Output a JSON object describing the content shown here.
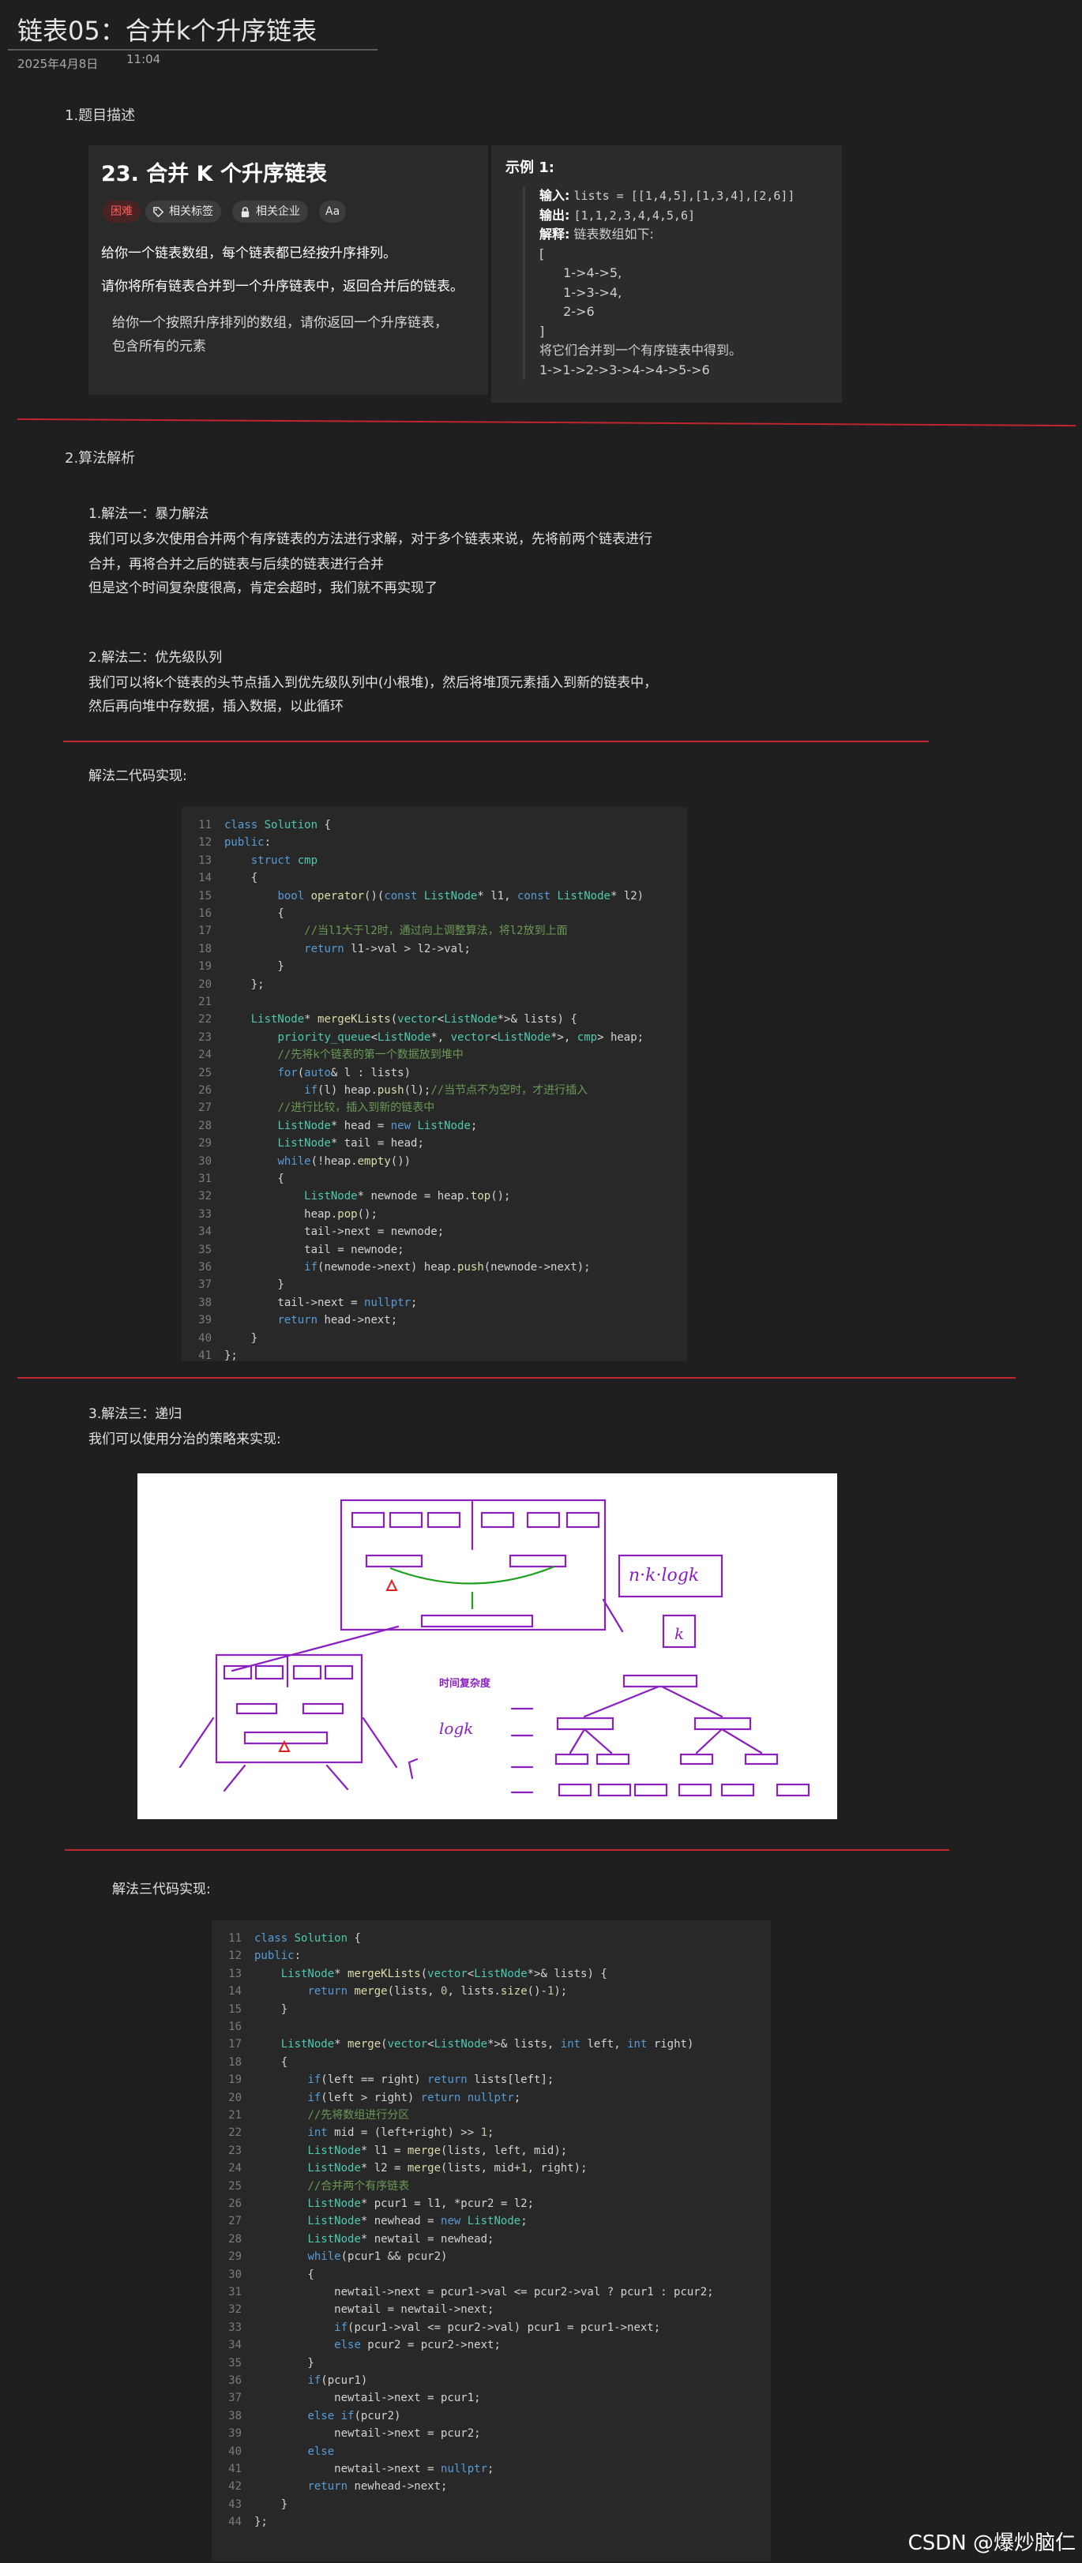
{
  "header": {
    "title": "链表05：合并k个升序链表",
    "date": "2025年4月8日",
    "time": "11:04"
  },
  "sections": {
    "s1": "1.题目描述",
    "s2": "2.算法解析",
    "code2_title": "解法二代码实现:",
    "code3_title": "解法三代码实现:"
  },
  "problem": {
    "title": "23. 合并 K 个升序链表",
    "tags": [
      "困难",
      "相关标签",
      "相关企业",
      "Aa"
    ],
    "desc1": "给你一个链表数组，每个链表都已经按升序排列。",
    "desc2": "请你将所有链表合并到一个升序链表中，返回合并后的链表。",
    "note1": "给你一个按照升序排列的数组，请你返回一个升序链表，",
    "note2": "包含所有的元素"
  },
  "example": {
    "title": "示例 1:",
    "input_k": "输入:",
    "input_v": "lists = [[1,4,5],[1,3,4],[2,6]]",
    "output_k": "输出:",
    "output_v": "[1,1,2,3,4,4,5,6]",
    "explain_k": "解释:",
    "explain_v": "链表数组如下:",
    "lines": [
      "[",
      "  1->4->5,",
      "  1->3->4,",
      "  2->6",
      "]"
    ],
    "merge_text": "将它们合并到一个有序链表中得到。",
    "result": "1->1->2->3->4->4->5->6"
  },
  "method1": {
    "title": "1.解法一：暴力解法",
    "lines": [
      "我们可以多次使用合并两个有序链表的方法进行求解，对于多个链表来说，先将前两个链表进行",
      "合并，再将合并之后的链表与后续的链表进行合并",
      "但是这个时间复杂度很高，肯定会超时，我们就不再实现了"
    ]
  },
  "method2": {
    "title": "2.解法二：优先级队列",
    "lines": [
      "我们可以将k个链表的头节点插入到优先级队列中(小根堆)，然后将堆顶元素插入到新的链表中，",
      "然后再向堆中存数据，插入数据，以此循环"
    ]
  },
  "method3": {
    "title": "3.解法三：递归",
    "desc": "我们可以使用分治的策略来实现:"
  },
  "diagram": {
    "label_complexity": "时间复杂度",
    "label_nk": "n·k·logk",
    "label_k": "k",
    "label_logk": "logk"
  },
  "code2": [
    {
      "n": "11",
      "t": "class Solution {"
    },
    {
      "n": "12",
      "t": "public:"
    },
    {
      "n": "13",
      "t": "    struct cmp"
    },
    {
      "n": "14",
      "t": "    {"
    },
    {
      "n": "15",
      "t": "        bool operator()(const ListNode* l1, const ListNode* l2)"
    },
    {
      "n": "16",
      "t": "        {"
    },
    {
      "n": "17",
      "t": "            //当l1大于l2时，通过向上调整算法，将l2放到上面"
    },
    {
      "n": "18",
      "t": "            return l1->val > l2->val;"
    },
    {
      "n": "19",
      "t": "        }"
    },
    {
      "n": "20",
      "t": "    };"
    },
    {
      "n": "21",
      "t": ""
    },
    {
      "n": "22",
      "t": "    ListNode* mergeKLists(vector<ListNode*>& lists) {"
    },
    {
      "n": "23",
      "t": "        priority_queue<ListNode*, vector<ListNode*>, cmp> heap;"
    },
    {
      "n": "24",
      "t": "        //先将k个链表的第一个数据放到堆中"
    },
    {
      "n": "25",
      "t": "        for(auto& l : lists)"
    },
    {
      "n": "26",
      "t": "            if(l) heap.push(l);//当节点不为空时，才进行插入"
    },
    {
      "n": "27",
      "t": "        //进行比较，插入到新的链表中"
    },
    {
      "n": "28",
      "t": "        ListNode* head = new ListNode;"
    },
    {
      "n": "29",
      "t": "        ListNode* tail = head;"
    },
    {
      "n": "30",
      "t": "        while(!heap.empty())"
    },
    {
      "n": "31",
      "t": "        {"
    },
    {
      "n": "32",
      "t": "            ListNode* newnode = heap.top();"
    },
    {
      "n": "33",
      "t": "            heap.pop();"
    },
    {
      "n": "34",
      "t": "            tail->next = newnode;"
    },
    {
      "n": "35",
      "t": "            tail = newnode;"
    },
    {
      "n": "36",
      "t": "            if(newnode->next) heap.push(newnode->next);"
    },
    {
      "n": "37",
      "t": "        }"
    },
    {
      "n": "38",
      "t": "        tail->next = nullptr;"
    },
    {
      "n": "39",
      "t": "        return head->next;"
    },
    {
      "n": "40",
      "t": "    }"
    },
    {
      "n": "41",
      "t": "};"
    }
  ],
  "code3": [
    {
      "n": "11",
      "t": "class Solution {"
    },
    {
      "n": "12",
      "t": "public:"
    },
    {
      "n": "13",
      "t": "    ListNode* mergeKLists(vector<ListNode*>& lists) {"
    },
    {
      "n": "14",
      "t": "        return merge(lists, 0, lists.size()-1);"
    },
    {
      "n": "15",
      "t": "    }"
    },
    {
      "n": "16",
      "t": ""
    },
    {
      "n": "17",
      "t": "    ListNode* merge(vector<ListNode*>& lists, int left, int right)"
    },
    {
      "n": "18",
      "t": "    {"
    },
    {
      "n": "19",
      "t": "        if(left == right) return lists[left];"
    },
    {
      "n": "20",
      "t": "        if(left > right) return nullptr;"
    },
    {
      "n": "21",
      "t": "        //先将数组进行分区"
    },
    {
      "n": "22",
      "t": "        int mid = (left+right) >> 1;"
    },
    {
      "n": "23",
      "t": "        ListNode* l1 = merge(lists, left, mid);"
    },
    {
      "n": "24",
      "t": "        ListNode* l2 = merge(lists, mid+1, right);"
    },
    {
      "n": "25",
      "t": "        //合并两个有序链表"
    },
    {
      "n": "26",
      "t": "        ListNode* pcur1 = l1, *pcur2 = l2;"
    },
    {
      "n": "27",
      "t": "        ListNode* newhead = new ListNode;"
    },
    {
      "n": "28",
      "t": "        ListNode* newtail = newhead;"
    },
    {
      "n": "29",
      "t": "        while(pcur1 && pcur2)"
    },
    {
      "n": "30",
      "t": "        {"
    },
    {
      "n": "31",
      "t": "            newtail->next = pcur1->val <= pcur2->val ? pcur1 : pcur2;"
    },
    {
      "n": "32",
      "t": "            newtail = newtail->next;"
    },
    {
      "n": "33",
      "t": "            if(pcur1->val <= pcur2->val) pcur1 = pcur1->next;"
    },
    {
      "n": "34",
      "t": "            else pcur2 = pcur2->next;"
    },
    {
      "n": "35",
      "t": "        }"
    },
    {
      "n": "36",
      "t": "        if(pcur1)"
    },
    {
      "n": "37",
      "t": "            newtail->next = pcur1;"
    },
    {
      "n": "38",
      "t": "        else if(pcur2)"
    },
    {
      "n": "39",
      "t": "            newtail->next = pcur2;"
    },
    {
      "n": "40",
      "t": "        else"
    },
    {
      "n": "41",
      "t": "            newtail->next = nullptr;"
    },
    {
      "n": "42",
      "t": "        return newhead->next;"
    },
    {
      "n": "43",
      "t": "    }"
    },
    {
      "n": "44",
      "t": "};"
    }
  ],
  "watermark": "CSDN @爆炒脑仁"
}
